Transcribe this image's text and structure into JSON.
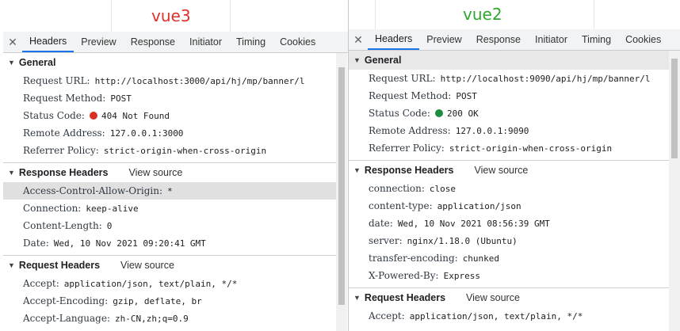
{
  "left": {
    "caption": "vue3",
    "caption_color": "#e0302a",
    "tabs": [
      "Headers",
      "Preview",
      "Response",
      "Initiator",
      "Timing",
      "Cookies"
    ],
    "general": {
      "title": "General",
      "rows": [
        {
          "key": "Request URL:",
          "val": "http://localhost:3000/api/hj/mp/banner/l"
        },
        {
          "key": "Request Method:",
          "val": "POST"
        },
        {
          "key": "Status Code:",
          "val": "404 Not Found",
          "status_color": "#d93025"
        },
        {
          "key": "Remote Address:",
          "val": "127.0.0.1:3000"
        },
        {
          "key": "Referrer Policy:",
          "val": "strict-origin-when-cross-origin"
        }
      ]
    },
    "response_headers": {
      "title": "Response Headers",
      "view_source": "View source",
      "rows": [
        {
          "key": "Access-Control-Allow-Origin:",
          "val": "*"
        },
        {
          "key": "Connection:",
          "val": "keep-alive"
        },
        {
          "key": "Content-Length:",
          "val": "0"
        },
        {
          "key": "Date:",
          "val": "Wed, 10 Nov 2021 09:20:41 GMT"
        }
      ]
    },
    "request_headers": {
      "title": "Request Headers",
      "view_source": "View source",
      "rows": [
        {
          "key": "Accept:",
          "val": "application/json, text/plain, */*"
        },
        {
          "key": "Accept-Encoding:",
          "val": "gzip, deflate, br"
        },
        {
          "key": "Accept-Language:",
          "val": "zh-CN,zh;q=0.9"
        }
      ]
    }
  },
  "right": {
    "caption": "vue2",
    "caption_color": "#2ea82e",
    "tabs": [
      "Headers",
      "Preview",
      "Response",
      "Initiator",
      "Timing",
      "Cookies"
    ],
    "general": {
      "title": "General",
      "rows": [
        {
          "key": "Request URL:",
          "val": "http://localhost:9090/api/hj/mp/banner/l"
        },
        {
          "key": "Request Method:",
          "val": "POST"
        },
        {
          "key": "Status Code:",
          "val": "200 OK",
          "status_color": "#1e8e3e"
        },
        {
          "key": "Remote Address:",
          "val": "127.0.0.1:9090"
        },
        {
          "key": "Referrer Policy:",
          "val": "strict-origin-when-cross-origin"
        }
      ]
    },
    "response_headers": {
      "title": "Response Headers",
      "view_source": "View source",
      "rows": [
        {
          "key": "connection:",
          "val": "close"
        },
        {
          "key": "content-type:",
          "val": "application/json"
        },
        {
          "key": "date:",
          "val": "Wed, 10 Nov 2021 08:56:39 GMT"
        },
        {
          "key": "server:",
          "val": "nginx/1.18.0 (Ubuntu)"
        },
        {
          "key": "transfer-encoding:",
          "val": "chunked"
        },
        {
          "key": "X-Powered-By:",
          "val": "Express"
        }
      ]
    },
    "request_headers": {
      "title": "Request Headers",
      "view_source": "View source",
      "rows": [
        {
          "key": "Accept:",
          "val": "application/json, text/plain, */*"
        }
      ]
    }
  }
}
